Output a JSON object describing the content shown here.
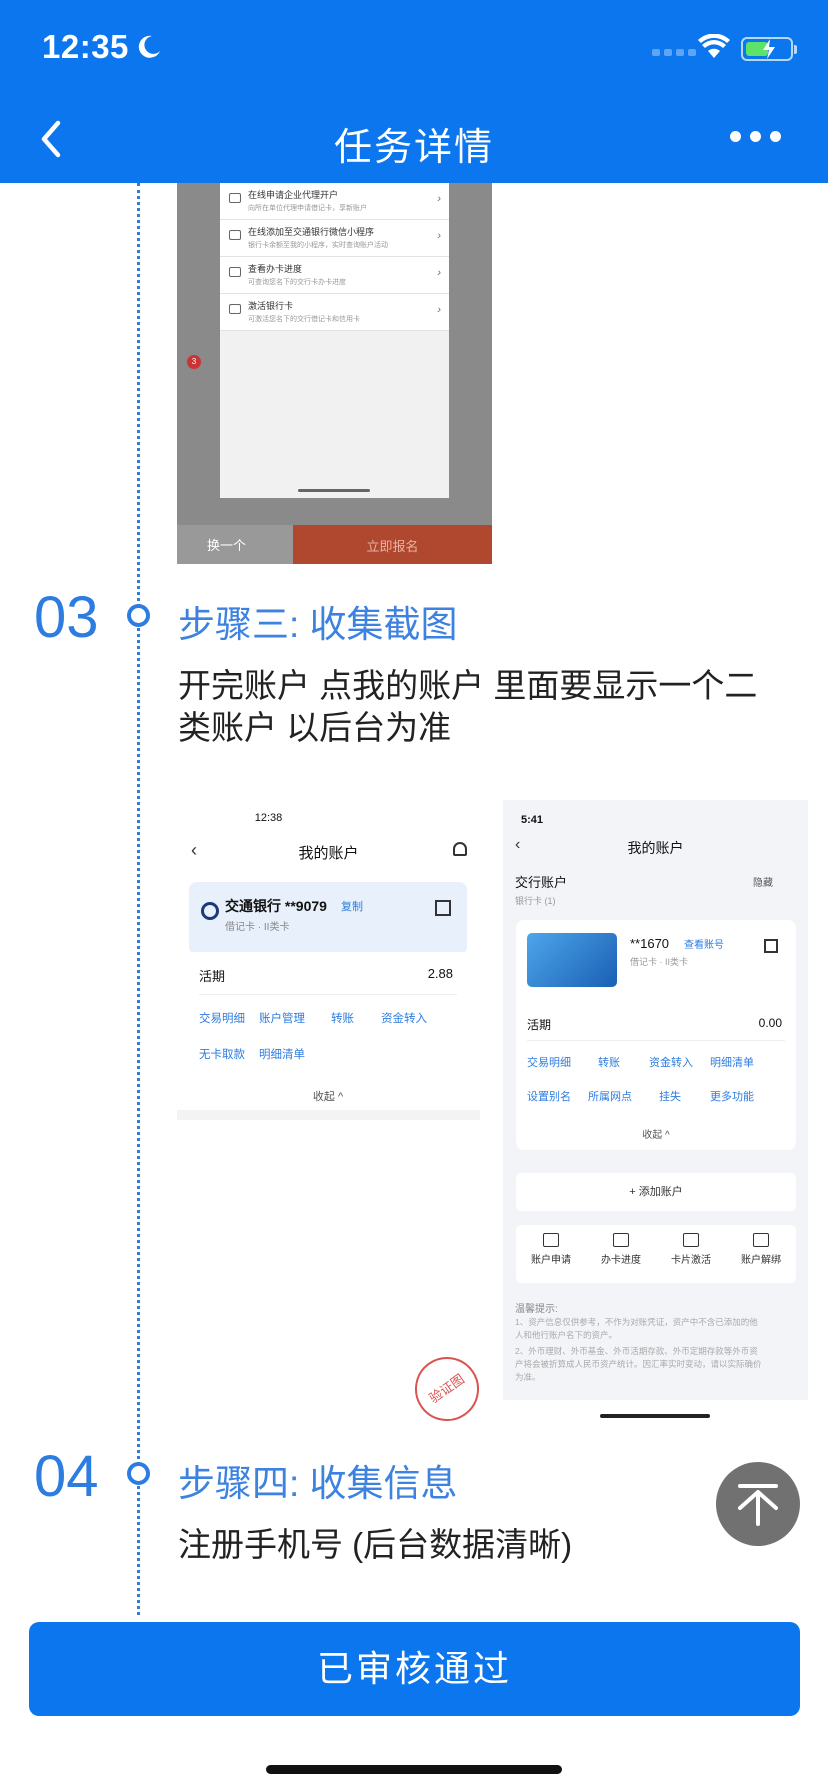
{
  "status_bar": {
    "time": "12:35"
  },
  "nav": {
    "title": "任务详情"
  },
  "screenshot1": {
    "rows": [
      {
        "label": "在线申请企业代理开户",
        "sub": "向所在单位代理申请借记卡，享新账户"
      },
      {
        "label": "在线添加至交通银行微信小程序",
        "sub": "银行卡余额至我的小程序，实时查询账户活动"
      },
      {
        "label": "查看办卡进度",
        "sub": "可查询您名下的交行卡办卡进度"
      },
      {
        "label": "激活银行卡",
        "sub": "可激活您名下的交行借记卡和信用卡"
      }
    ],
    "step_badge": "3",
    "left_button": "换一个",
    "right_button": "立即报名"
  },
  "steps": [
    {
      "num": "03",
      "title": "步骤三: 收集截图",
      "desc": [
        "开完账户  点我的账户 里面要显示一个二",
        "类账户 以后台为准"
      ]
    },
    {
      "num": "04",
      "title": "步骤四: 收集信息",
      "desc": [
        "注册手机号 (后台数据清晰)"
      ]
    }
  ],
  "screenshot2": {
    "status_time": "12:38",
    "title": "我的账户",
    "bank": "交通银行 **9079",
    "copy": "复制",
    "card_type": "借记卡 · II类卡",
    "huoqi": "活期",
    "balance": "2.88",
    "actions": [
      "交易明细",
      "账户管理",
      "转账",
      "资金转入",
      "无卡取款",
      "明细清单"
    ],
    "collapse": "收起 ^",
    "stamp": "验证图"
  },
  "screenshot3": {
    "status_time": "5:41",
    "title": "我的账户",
    "account_title": "交行账户",
    "account_sub": "银行卡 (1)",
    "hide": "隐藏",
    "card_num": "**1670",
    "check": "查看账号",
    "card_type": "借记卡 · II类卡",
    "huoqi": "活期",
    "balance": "0.00",
    "actions": [
      "交易明细",
      "转账",
      "资金转入",
      "明细清单",
      "设置别名",
      "所属网点",
      "挂失",
      "更多功能"
    ],
    "collapse": "收起 ^",
    "add": "+ 添加账户",
    "tools": [
      "账户申请",
      "办卡进度",
      "卡片激活",
      "账户解绑"
    ],
    "tip_head": "温馨提示:",
    "tips": [
      "1、资产信息仅供参考，不作为对账凭证，资产中不含已添加的他",
      "人和他行账户名下的资产。",
      "2、外币理财、外币基金、外币活期存款、外币定期存款等外币资",
      "产将会被折算成人民币资产统计。因汇率实时变动，请以实际确价",
      "为准。"
    ]
  },
  "submit": {
    "label": "已审核通过"
  },
  "colors": {
    "primary": "#0b76ed",
    "step": "#2d7ce0"
  }
}
